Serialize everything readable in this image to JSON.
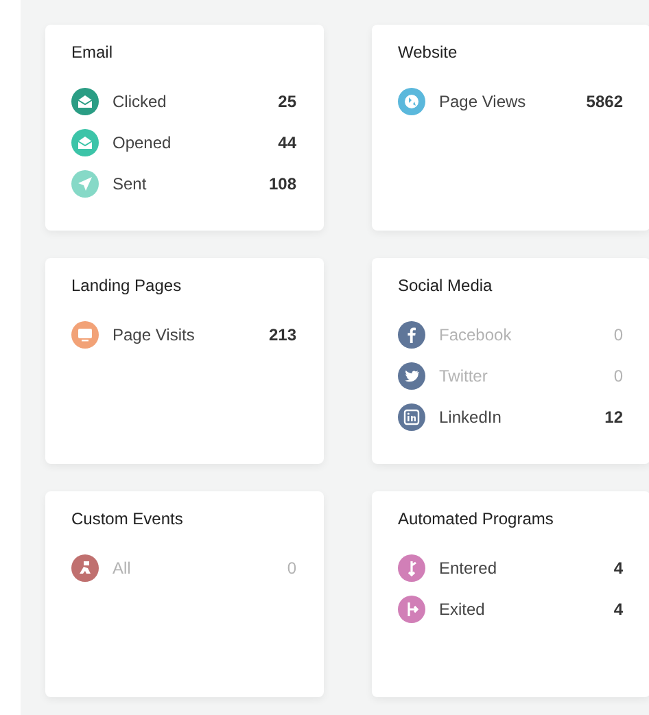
{
  "cards": [
    {
      "title": "Email",
      "items": [
        {
          "kind": "envelope",
          "color": "#2a9d84",
          "label": "Clicked",
          "value": "25",
          "muted": false
        },
        {
          "kind": "envelope",
          "color": "#3cc4a8",
          "label": "Opened",
          "value": "44",
          "muted": false
        },
        {
          "kind": "plane",
          "color": "#86d9c7",
          "label": "Sent",
          "value": "108",
          "muted": false
        }
      ]
    },
    {
      "title": "Website",
      "items": [
        {
          "kind": "globe",
          "color": "#5bb8dc",
          "label": "Page Views",
          "value": "5862",
          "muted": false
        }
      ]
    },
    {
      "title": "Landing Pages",
      "items": [
        {
          "kind": "monitor",
          "color": "#f2a277",
          "label": "Page Visits",
          "value": "213",
          "muted": false
        }
      ]
    },
    {
      "title": "Social Media",
      "items": [
        {
          "kind": "facebook",
          "color": "#5f7699",
          "label": "Facebook",
          "value": "0",
          "muted": true
        },
        {
          "kind": "twitter",
          "color": "#5f7699",
          "label": "Twitter",
          "value": "0",
          "muted": true
        },
        {
          "kind": "linkedin",
          "color": "#5f7699",
          "label": "LinkedIn",
          "value": "12",
          "muted": false
        }
      ]
    },
    {
      "title": "Custom Events",
      "items": [
        {
          "kind": "custom",
          "color": "#c0706f",
          "label": "All",
          "value": "0",
          "muted": true
        }
      ]
    },
    {
      "title": "Automated Programs",
      "items": [
        {
          "kind": "enter",
          "color": "#d17fb7",
          "label": "Entered",
          "value": "4",
          "muted": false
        },
        {
          "kind": "exit",
          "color": "#d17fb7",
          "label": "Exited",
          "value": "4",
          "muted": false
        }
      ]
    }
  ]
}
